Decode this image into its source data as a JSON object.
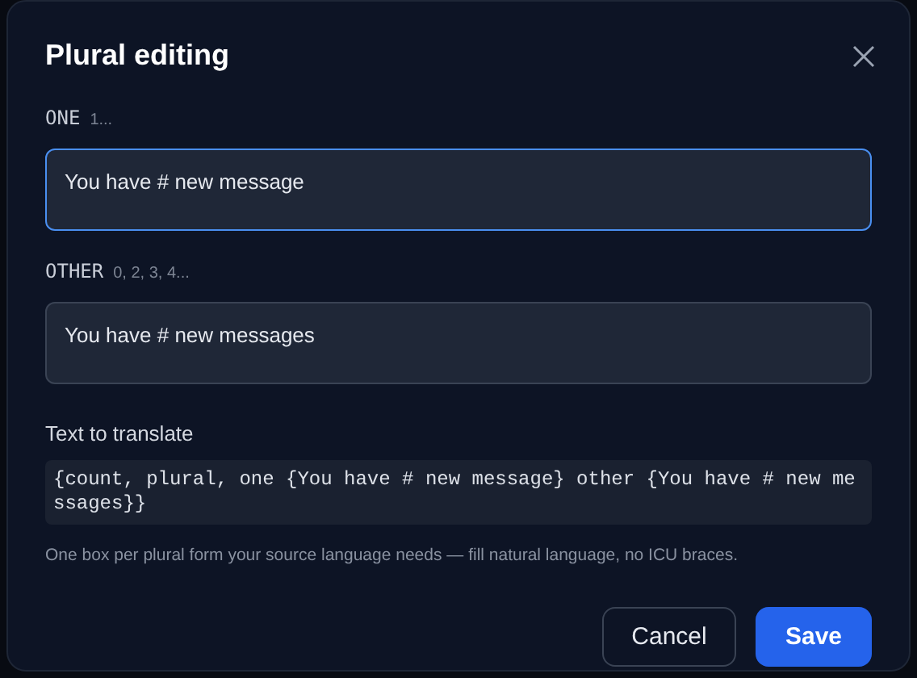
{
  "dialog": {
    "title": "Plural editing"
  },
  "forms": [
    {
      "category": "ONE",
      "examples": "1...",
      "value": "You have # new message",
      "focused": true
    },
    {
      "category": "OTHER",
      "examples": "0, 2, 3, 4...",
      "value": "You have # new messages",
      "focused": false
    }
  ],
  "source": {
    "label": "Text to translate",
    "code": "{count, plural, one {You have # new message} other {You have # new messages}}"
  },
  "hint": "One box per plural form your source language needs — fill natural language, no ICU braces.",
  "buttons": [
    {
      "label": "Cancel",
      "kind": "secondary"
    },
    {
      "label": "Save",
      "kind": "primary"
    }
  ]
}
